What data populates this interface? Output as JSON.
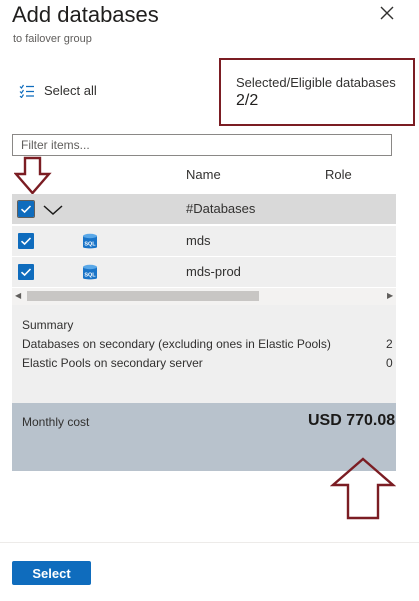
{
  "header": {
    "title": "Add databases",
    "subtitle": "to failover group",
    "close_icon": "close-icon"
  },
  "toolbar": {
    "select_all_label": "Select all",
    "select_all_icon": "checklist-icon"
  },
  "selection": {
    "label": "Selected/Eligible databases",
    "value": "2/2"
  },
  "filter": {
    "placeholder": "Filter items...",
    "value": ""
  },
  "table": {
    "columns": [
      "Name",
      "Role"
    ],
    "rows": [
      {
        "checked": true,
        "expandable": true,
        "icon": "",
        "name": "#Databases"
      },
      {
        "checked": true,
        "expandable": false,
        "icon": "sql-database-icon",
        "icon_text": "SQL",
        "name": "mds"
      },
      {
        "checked": true,
        "expandable": false,
        "icon": "sql-database-icon",
        "icon_text": "SQL",
        "name": "mds-prod"
      }
    ]
  },
  "summary": {
    "title": "Summary",
    "items": [
      {
        "label": "Databases on secondary (excluding ones in Elastic Pools)",
        "value": "2"
      },
      {
        "label": "Elastic Pools on secondary server",
        "value": "0"
      }
    ]
  },
  "cost": {
    "label": "Monthly cost",
    "value": "USD 770.08"
  },
  "footer": {
    "select_button": "Select"
  },
  "colors": {
    "accent": "#0f6cbd",
    "annotation": "#7b1d23",
    "cost_background": "#b8c2cc"
  }
}
